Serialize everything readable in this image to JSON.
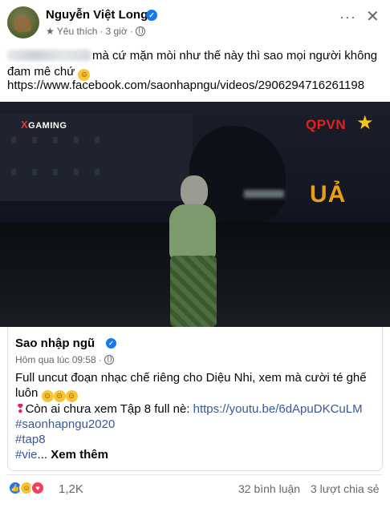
{
  "post": {
    "author": "Nguyễn Việt Long",
    "verified": "✓",
    "like_label": "Yêu thích",
    "dot": "·",
    "time": "3 giờ",
    "text_line1": "mà cứ mặn mòi như thế này thì sao mọi người không",
    "text_line2": "đam mê chứ",
    "link": "https://www.facebook.com/saonhapngu/videos/2906294716261198",
    "more_label": "···",
    "close_label": "✕"
  },
  "video": {
    "brand_left": "GAMING",
    "brand_left_x": "X",
    "brand_right": "QPVN",
    "overlay": "UẢ",
    "mute_icon": "🔇"
  },
  "shared": {
    "author": "Sao nhập ngũ",
    "time": "Hôm qua lúc 09:58",
    "dot": "·",
    "text_line1": "Full uncut đoạn nhạc chế riêng cho Diệu Nhi, xem mà cười té ghế",
    "text_line2": "luôn",
    "line3_prefix": "Còn ai chưa xem Tập 8 full nè: ",
    "line3_link": "https://youtu.be/6dApuDKCuLM",
    "hashtag1": "#saonhapngu2020",
    "hashtag2": "#tap8",
    "hashtag3": "#vie",
    "ellipsis": "...",
    "see_more": "Xem thêm"
  },
  "footer": {
    "reaction_count": "1,2K",
    "comments": "32 bình luận",
    "shares": "3 lượt chia sẻ"
  },
  "colors": {
    "accent": "#1877f2",
    "link_blue": "#385898",
    "secondary_text": "#65676b"
  }
}
